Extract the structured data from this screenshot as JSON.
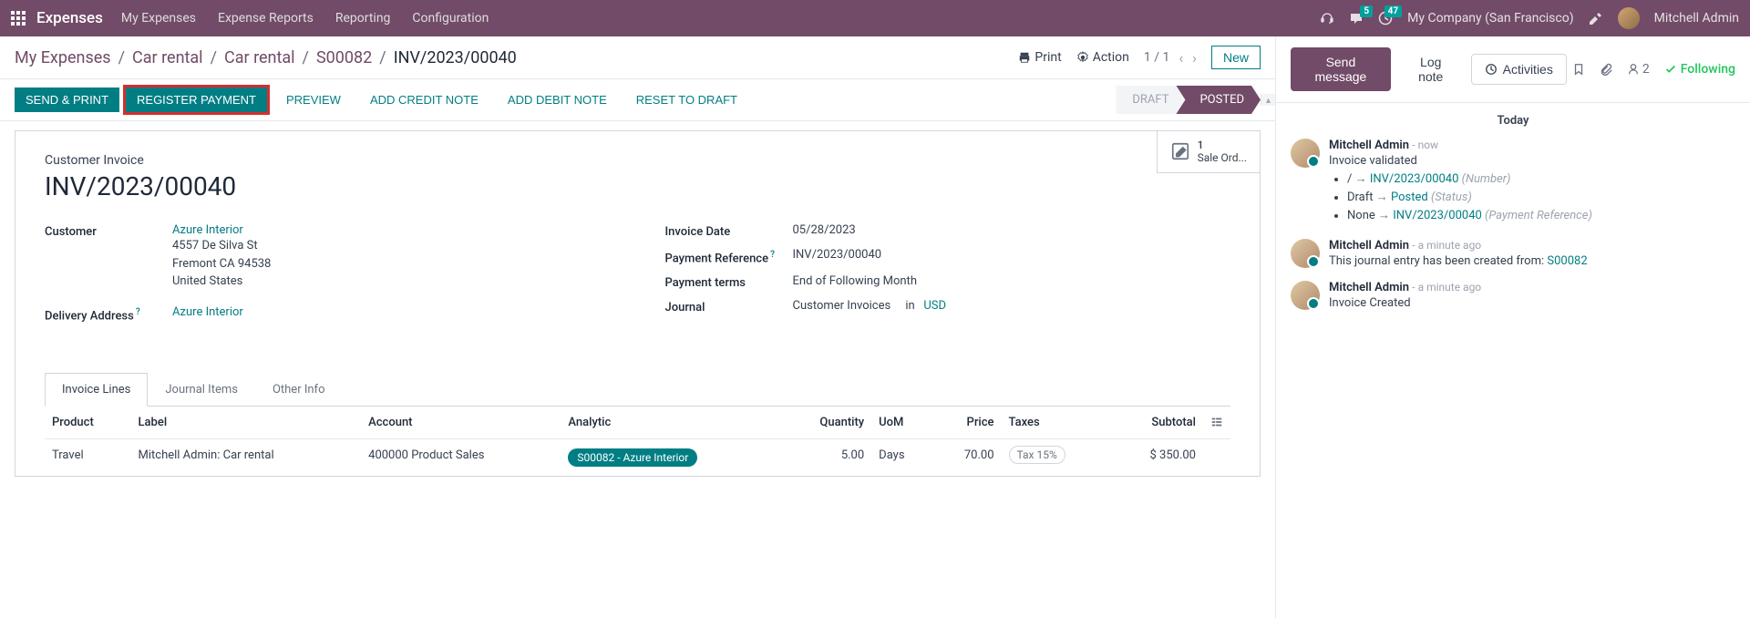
{
  "navbar": {
    "brand": "Expenses",
    "menu": [
      "My Expenses",
      "Expense Reports",
      "Reporting",
      "Configuration"
    ],
    "chat_badge": "5",
    "clock_badge": "47",
    "company": "My Company (San Francisco)",
    "user": "Mitchell Admin"
  },
  "breadcrumb": {
    "items": [
      "My Expenses",
      "Car rental",
      "Car rental",
      "S00082"
    ],
    "current": "INV/2023/00040"
  },
  "controls": {
    "print": "Print",
    "action": "Action",
    "pager": "1 / 1",
    "new": "New"
  },
  "actions": {
    "send_print": "SEND & PRINT",
    "register_payment": "REGISTER PAYMENT",
    "preview": "PREVIEW",
    "add_credit": "ADD CREDIT NOTE",
    "add_debit": "ADD DEBIT NOTE",
    "reset_draft": "RESET TO DRAFT"
  },
  "status": {
    "draft": "DRAFT",
    "posted": "POSTED"
  },
  "stat_button": {
    "count": "1",
    "label": "Sale Ord..."
  },
  "invoice": {
    "type_label": "Customer Invoice",
    "number": "INV/2023/00040",
    "customer_label": "Customer",
    "customer_name": "Azure Interior",
    "addr1": "4557 De Silva St",
    "addr2": "Fremont CA 94538",
    "addr3": "United States",
    "delivery_label": "Delivery Address",
    "delivery_value": "Azure Interior",
    "invoice_date_label": "Invoice Date",
    "invoice_date": "05/28/2023",
    "payment_ref_label": "Payment Reference",
    "payment_ref": "INV/2023/00040",
    "terms_label": "Payment terms",
    "terms": "End of Following Month",
    "journal_label": "Journal",
    "journal": "Customer Invoices",
    "journal_in": "in",
    "currency": "USD"
  },
  "tabs": {
    "lines": "Invoice Lines",
    "journal": "Journal Items",
    "other": "Other Info"
  },
  "table": {
    "headers": {
      "product": "Product",
      "label": "Label",
      "account": "Account",
      "analytic": "Analytic",
      "quantity": "Quantity",
      "uom": "UoM",
      "price": "Price",
      "taxes": "Taxes",
      "subtotal": "Subtotal"
    },
    "row": {
      "product": "Travel",
      "label": "Mitchell Admin: Car rental",
      "account": "400000 Product Sales",
      "analytic": "S00082 - Azure Interior",
      "quantity": "5.00",
      "uom": "Days",
      "price": "70.00",
      "tax": "Tax 15%",
      "subtotal": "$ 350.00"
    }
  },
  "chatter": {
    "send": "Send message",
    "log": "Log note",
    "activities": "Activities",
    "followers": "2",
    "following": "Following",
    "today": "Today",
    "msgs": [
      {
        "author": "Mitchell Admin",
        "time": "- now",
        "text": "Invoice validated",
        "changes": [
          {
            "before": "/",
            "after": "INV/2023/00040",
            "field": "(Number)"
          },
          {
            "before": "Draft",
            "after": "Posted",
            "field": "(Status)"
          },
          {
            "before": "None",
            "after": "INV/2023/00040",
            "field": "(Payment Reference)"
          }
        ]
      },
      {
        "author": "Mitchell Admin",
        "time": "- a minute ago",
        "text_prefix": "This journal entry has been created from: ",
        "link": "S00082"
      },
      {
        "author": "Mitchell Admin",
        "time": "- a minute ago",
        "text": "Invoice Created"
      }
    ]
  }
}
